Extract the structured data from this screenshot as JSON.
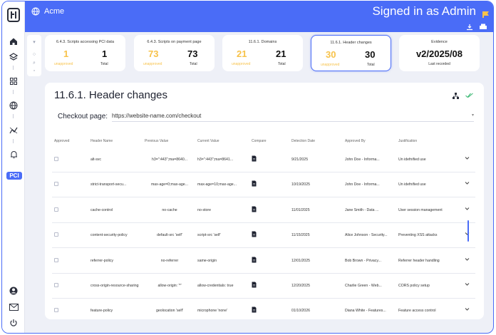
{
  "app": {
    "title": "Acme",
    "user_status": "Signed in as Admin"
  },
  "sidebar": {
    "badge": "PCI",
    "icons": [
      "home-icon",
      "layers-icon",
      "grid-icon",
      "globe-icon",
      "chart-icon",
      "bell-icon",
      "user-icon",
      "mail-icon",
      "power-icon"
    ]
  },
  "cards": [
    {
      "title": "6.4.3. Scripts accessing PCI data",
      "unapproved": "1",
      "unapproved_label": "unapproved",
      "total": "1",
      "total_label": "Total"
    },
    {
      "title": "6.4.3. Scripts on payment page",
      "unapproved": "73",
      "unapproved_label": "unapproved",
      "total": "73",
      "total_label": "Total"
    },
    {
      "title": "11.6.1. Domains",
      "unapproved": "21",
      "unapproved_label": "unapproved",
      "total": "21",
      "total_label": "Total"
    },
    {
      "title": "11.6.1. Header changes",
      "unapproved": "30",
      "unapproved_label": "unapproved",
      "total": "30",
      "total_label": "Total"
    }
  ],
  "evidence": {
    "title": "Evidence",
    "value": "v2/2025/08",
    "label": "Last recorded"
  },
  "panel": {
    "title": "11.6.1. Header changes",
    "page_label": "Checkout page:",
    "page_value": "https://website-name.com/checkout"
  },
  "table": {
    "columns": [
      "Approved",
      "Header Name",
      "Previous Value",
      "Current Value",
      "Compare",
      "Detection Date",
      "Approved By",
      "Justification"
    ],
    "rows": [
      {
        "header": "alt-svc",
        "previous": "h3=\":443\";ma=8640...",
        "current": "h3=\":443\";ma=8641...",
        "date": "9/21/2025",
        "by": "John Doe - Informa...",
        "justification": "Un idefnified use"
      },
      {
        "header": "strict-transport-secu...",
        "previous": "max-age=0;max-age...",
        "current": "max-age=10;max-age...",
        "date": "10/19/2025",
        "by": "John Doe - Informa...",
        "justification": "Un idefnified use"
      },
      {
        "header": "cache-control",
        "previous": "no-cache",
        "current": "no-store",
        "date": "11/01/2025",
        "by": "Jane Smith - Data ...",
        "justification": "User session management"
      },
      {
        "header": "content-security-policy",
        "previous": "default-src 'self'",
        "current": "script-src 'self'",
        "date": "11/15/2025",
        "by": "Alice Johnson - Security...",
        "justification": "Preventing XSS attacks"
      },
      {
        "header": "referrer-policy",
        "previous": "no-referrer",
        "current": "same-origin",
        "date": "12/01/2025",
        "by": "Bob Brown - Privacy...",
        "justification": "Referrer header handling"
      },
      {
        "header": "cross-origin-resource-sharing",
        "previous": "allow-origin: '*'",
        "current": "allow-credentials: true",
        "date": "12/20/2025",
        "by": "Charlie Green - Web...",
        "justification": "CORS policy setup"
      },
      {
        "header": "feature-policy",
        "previous": "geolocation 'self'",
        "current": "microphone 'none'",
        "date": "01/10/2026",
        "by": "Diana White - Features...",
        "justification": "Feature access control"
      }
    ]
  },
  "colors": {
    "accent": "#4a6cf7",
    "unapproved": "#f7c24a",
    "approved_check": "#3bb873"
  }
}
